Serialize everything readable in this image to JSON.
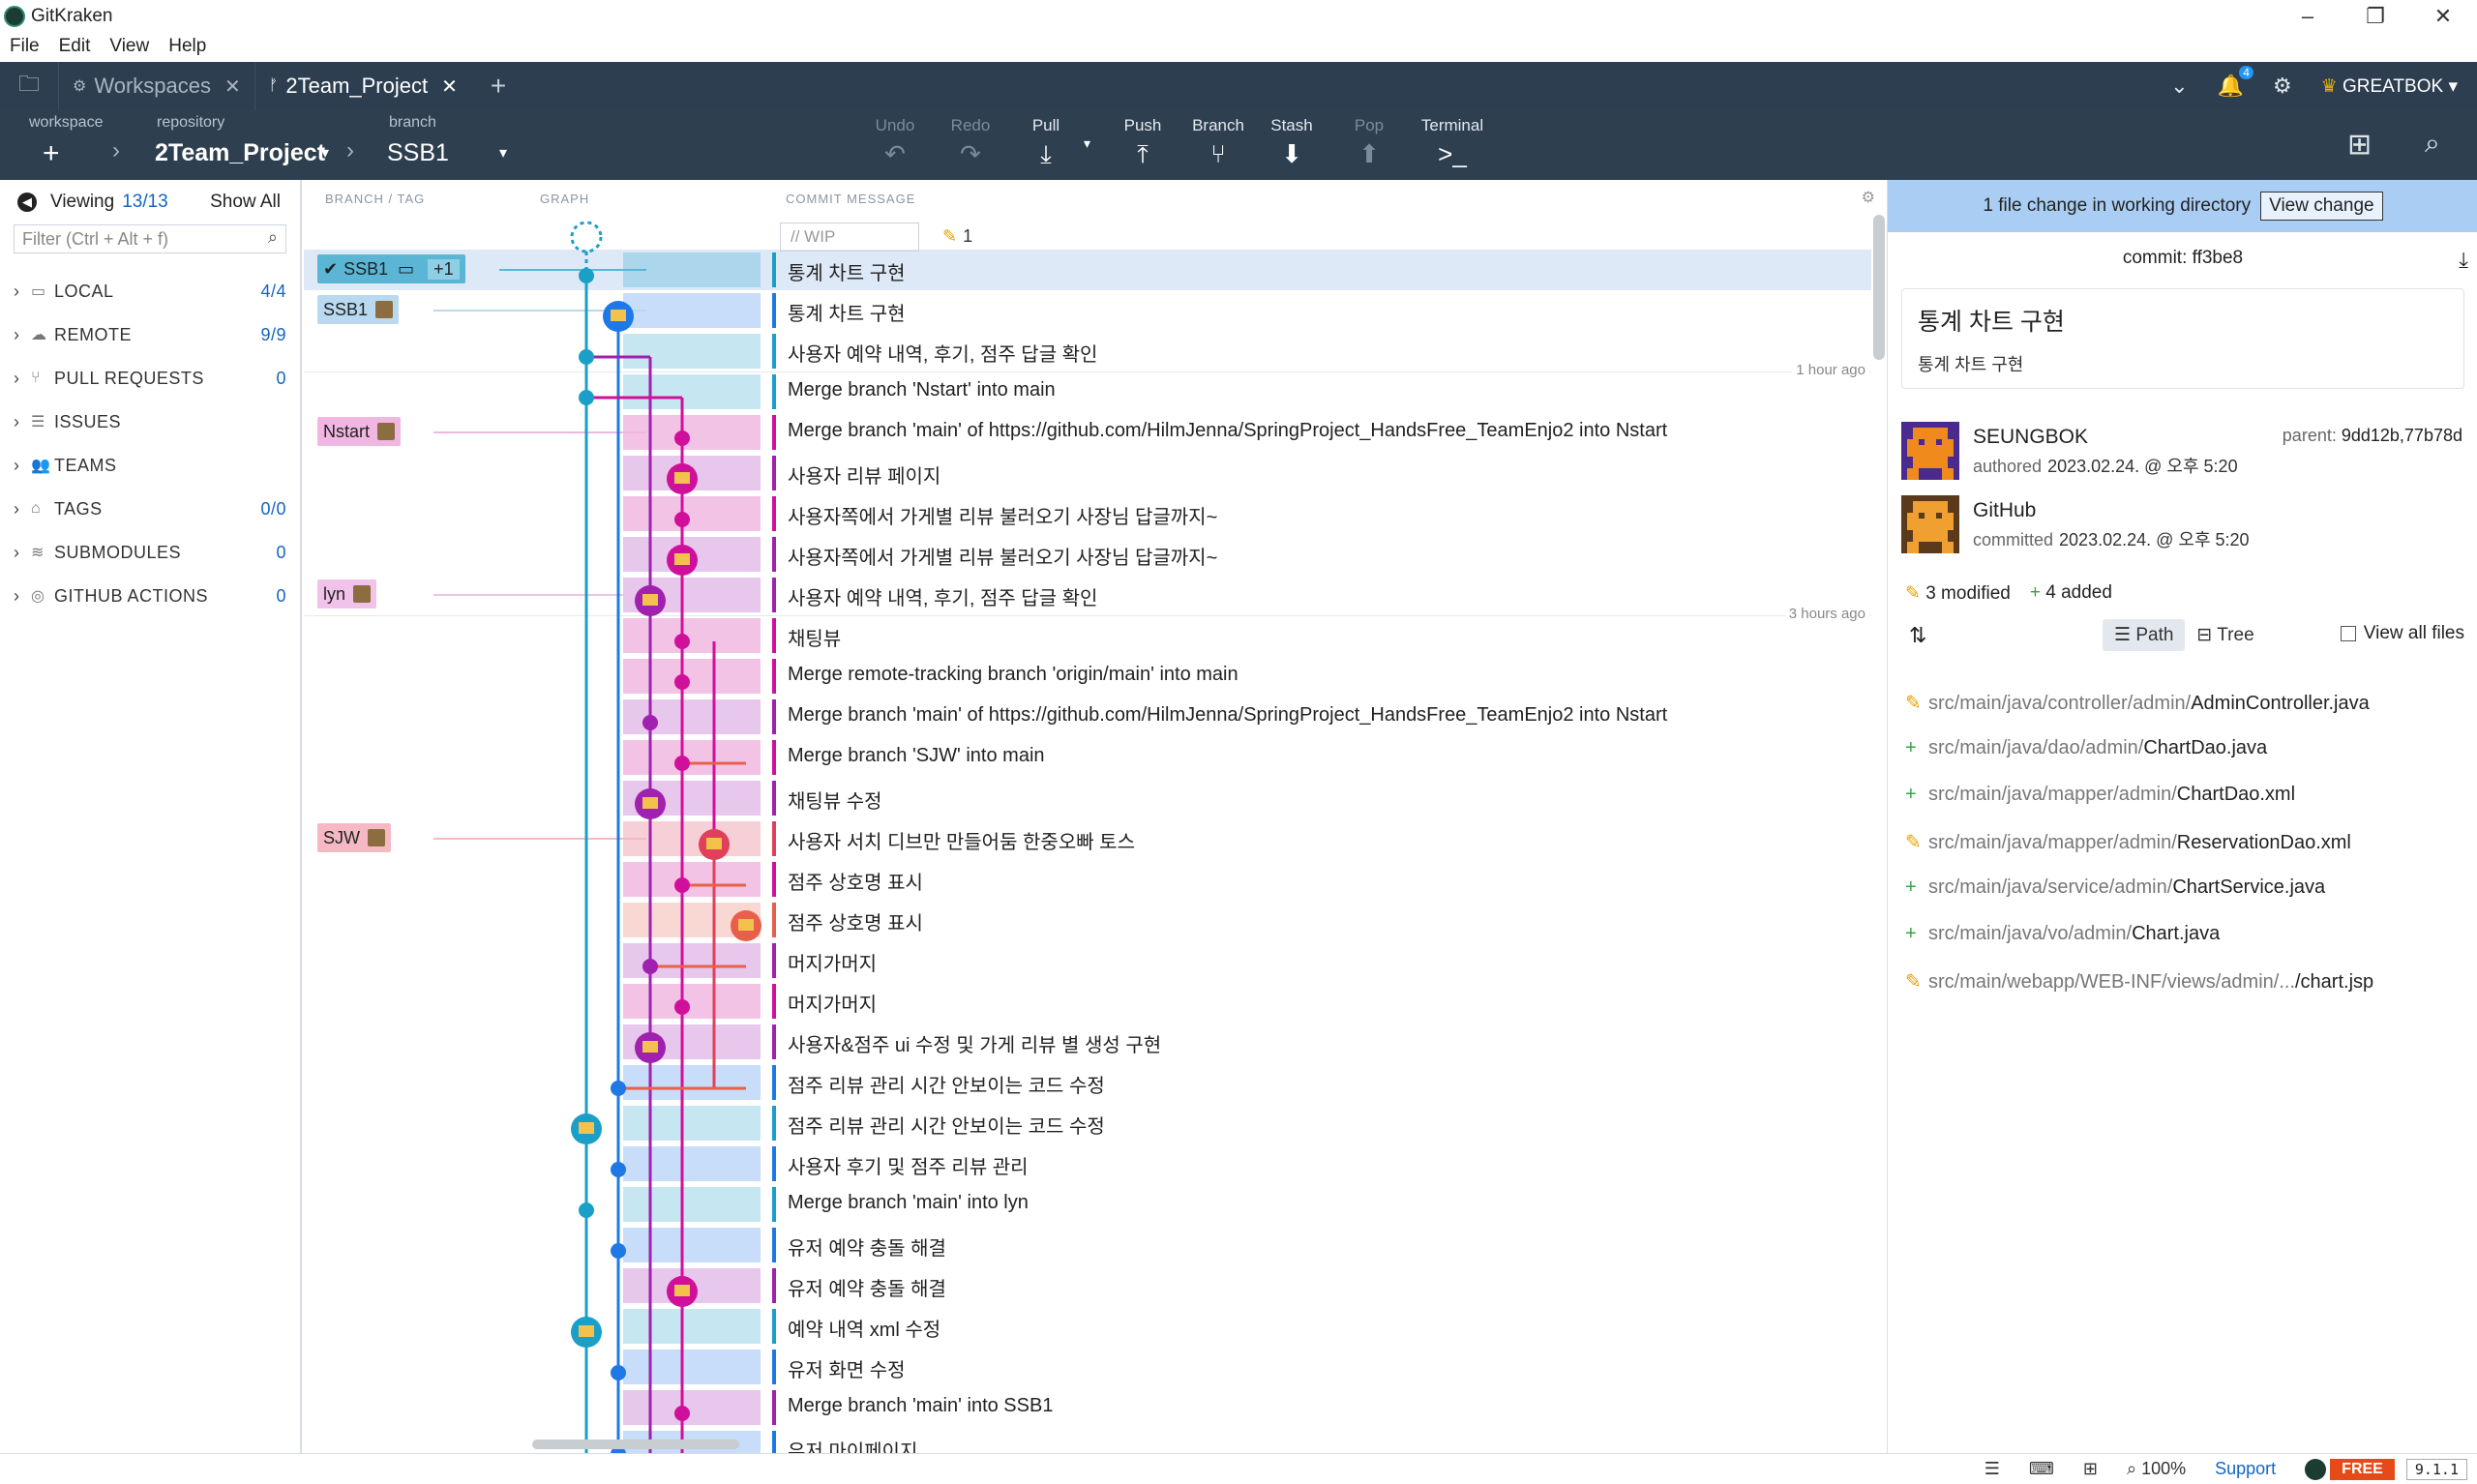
{
  "window": {
    "title": "GitKraken",
    "controls": [
      "–",
      "❐",
      "✕"
    ]
  },
  "menu": [
    "File",
    "Edit",
    "View",
    "Help"
  ],
  "tabs": [
    {
      "label": "Workspaces",
      "icon": "workspaces-icon"
    },
    {
      "label": "2Team_Project",
      "icon": "repo-icon",
      "active": true
    }
  ],
  "header_right": {
    "notifications": "4",
    "user": "GREATBOK"
  },
  "toolbar": {
    "workspace_label": "workspace",
    "repository_label": "repository",
    "repository": "2Team_Project",
    "branch_label": "branch",
    "branch": "SSB1",
    "buttons": {
      "undo": "Undo",
      "redo": "Redo",
      "pull": "Pull",
      "push": "Push",
      "branch": "Branch",
      "stash": "Stash",
      "pop": "Pop",
      "terminal": "Terminal"
    }
  },
  "left": {
    "viewing_label": "Viewing",
    "viewing_count": "13/13",
    "show_all": "Show All",
    "filter_placeholder": "Filter (Ctrl + Alt + f)",
    "sections": [
      {
        "label": "LOCAL",
        "count": "4/4",
        "icon": "laptop-icon"
      },
      {
        "label": "REMOTE",
        "count": "9/9",
        "icon": "cloud-icon"
      },
      {
        "label": "PULL REQUESTS",
        "count": "0",
        "icon": "pull-request-icon"
      },
      {
        "label": "ISSUES",
        "count": "",
        "icon": "issues-icon"
      },
      {
        "label": "TEAMS",
        "count": "",
        "icon": "teams-icon"
      },
      {
        "label": "TAGS",
        "count": "0/0",
        "icon": "tag-icon"
      },
      {
        "label": "SUBMODULES",
        "count": "0",
        "icon": "submodule-icon"
      },
      {
        "label": "GITHUB ACTIONS",
        "count": "0",
        "icon": "actions-icon"
      }
    ]
  },
  "graph": {
    "headers": {
      "branch": "BRANCH / TAG",
      "graph": "GRAPH",
      "message": "COMMIT MESSAGE"
    },
    "wip_placeholder": "// WIP",
    "wip_count": "1",
    "refs": [
      {
        "label": "SSB1",
        "extra": "+1",
        "color": "#5bb6d6"
      },
      {
        "label": "SSB1",
        "color": "#b9d9f0"
      },
      {
        "label": "Nstart",
        "color": "#f1b6e1"
      },
      {
        "label": "lyn",
        "color": "#f1c2ea"
      },
      {
        "label": "SJW",
        "color": "#f6b9c3"
      }
    ],
    "time_markers": [
      "1 hour ago",
      "3 hours ago"
    ],
    "commits": [
      {
        "msg": "통계 차트 구현",
        "color": "#1aa0c8"
      },
      {
        "msg": "통계 차트 구현",
        "color": "#1e78e6"
      },
      {
        "msg": "사용자 예약 내역, 후기, 점주 답글 확인",
        "color": "#1aa0c8"
      },
      {
        "msg": "Merge branch 'Nstart' into main",
        "color": "#1aa0c8"
      },
      {
        "msg": "Merge branch 'main' of https://github.com/HilmJenna/SpringProject_HandsFree_TeamEnjo2 into Nstart",
        "color": "#d0109a"
      },
      {
        "msg": "사용자 리뷰 페이지",
        "color": "#a020b0"
      },
      {
        "msg": "사용자쪽에서 가게별 리뷰 불러오기 사장님 답글까지~",
        "color": "#d0109a"
      },
      {
        "msg": "사용자쪽에서 가게별 리뷰 불러오기 사장님 답글까지~",
        "color": "#a020b0"
      },
      {
        "msg": "사용자 예약 내역, 후기, 점주 답글 확인",
        "color": "#a020b0"
      },
      {
        "msg": "채팅뷰",
        "color": "#d0109a"
      },
      {
        "msg": "Merge remote-tracking branch 'origin/main' into main",
        "color": "#d0109a"
      },
      {
        "msg": "Merge branch 'main' of https://github.com/HilmJenna/SpringProject_HandsFree_TeamEnjo2 into Nstart",
        "color": "#a020b0"
      },
      {
        "msg": "Merge branch 'SJW' into main",
        "color": "#d0109a"
      },
      {
        "msg": "채팅뷰 수정",
        "color": "#a020b0"
      },
      {
        "msg": "사용자 서치 디브만 만들어둠 한중오빠 토스",
        "color": "#e0405a"
      },
      {
        "msg": "점주 상호명 표시",
        "color": "#d0109a"
      },
      {
        "msg": "점주 상호명 표시",
        "color": "#e8604a"
      },
      {
        "msg": "머지가머지",
        "color": "#a020b0"
      },
      {
        "msg": "머지가머지",
        "color": "#d0109a"
      },
      {
        "msg": "사용자&점주 ui 수정 및 가게 리뷰 별 생성 구현",
        "color": "#a020b0"
      },
      {
        "msg": "점주 리뷰 관리 시간 안보이는 코드 수정",
        "color": "#1e78e6"
      },
      {
        "msg": "점주 리뷰 관리 시간 안보이는 코드 수정",
        "color": "#1aa0c8"
      },
      {
        "msg": "사용자 후기 및 점주 리뷰 관리",
        "color": "#1e78e6"
      },
      {
        "msg": "Merge branch 'main' into lyn",
        "color": "#1aa0c8"
      },
      {
        "msg": "유저 예약 충돌 해결",
        "color": "#1e78e6"
      },
      {
        "msg": "유저 예약 충돌 해결",
        "color": "#a020b0"
      },
      {
        "msg": "예약 내역 xml 수정",
        "color": "#1aa0c8"
      },
      {
        "msg": "유저 화면 수정",
        "color": "#1e78e6"
      },
      {
        "msg": "Merge branch 'main' into SSB1",
        "color": "#a020b0"
      },
      {
        "msg": "유저 마이페이지",
        "color": "#1e78e6"
      }
    ]
  },
  "right": {
    "banner_text": "1 file change in working directory",
    "view_change": "View change",
    "commit_label": "commit:",
    "commit_sha": "ff3be8",
    "summary": "통계 차트 구현",
    "description": "통계 차트 구현",
    "author": {
      "name": "SEUNGBOK",
      "verb": "authored",
      "date": "2023.02.24. @ 오후 5:20"
    },
    "parent_label": "parent:",
    "parent": "9dd12b,77b78d",
    "committer": {
      "name": "GitHub",
      "verb": "committed",
      "date": "2023.02.24. @ 오후 5:20"
    },
    "modified": "3 modified",
    "added": "4 added",
    "view_path": "Path",
    "view_tree": "Tree",
    "view_all_files": "View all files",
    "files": [
      {
        "status": "modified",
        "dir": "src/main/java/controller/admin/",
        "name": "AdminController.java"
      },
      {
        "status": "added",
        "dir": "src/main/java/dao/admin/",
        "name": "ChartDao.java"
      },
      {
        "status": "added",
        "dir": "src/main/java/mapper/admin/",
        "name": "ChartDao.xml"
      },
      {
        "status": "modified",
        "dir": "src/main/java/mapper/admin/",
        "name": "ReservationDao.xml"
      },
      {
        "status": "added",
        "dir": "src/main/java/service/admin/",
        "name": "ChartService.java"
      },
      {
        "status": "added",
        "dir": "src/main/java/vo/admin/",
        "name": "Chart.java"
      },
      {
        "status": "modified",
        "dir": "src/main/webapp/WEB-INF/views/admin/...",
        "name": "/chart.jsp"
      }
    ]
  },
  "status": {
    "zoom": "100%",
    "support": "Support",
    "plan": "FREE",
    "version": "9.1.1"
  }
}
